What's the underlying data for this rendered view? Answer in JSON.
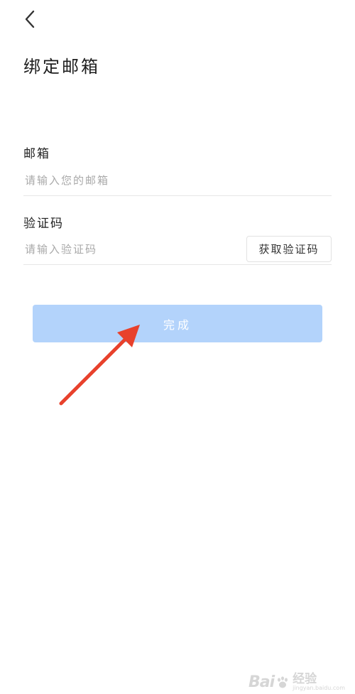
{
  "header": {
    "back_icon": "chevron-left-icon",
    "title": "绑定邮箱"
  },
  "form": {
    "email": {
      "label": "邮箱",
      "placeholder": "请输入您的邮箱",
      "value": ""
    },
    "code": {
      "label": "验证码",
      "placeholder": "请输入验证码",
      "value": "",
      "get_code_label": "获取验证码"
    },
    "submit_label": "完成"
  },
  "annotation": {
    "arrow_color": "#e8412c"
  },
  "watermark": {
    "brand": "Bai",
    "cn": "经验",
    "url": "jingyan.baidu.com"
  },
  "colors": {
    "submit_bg": "#b3d3fb",
    "placeholder": "#a9a9a9",
    "divider": "#e6e6e6"
  }
}
